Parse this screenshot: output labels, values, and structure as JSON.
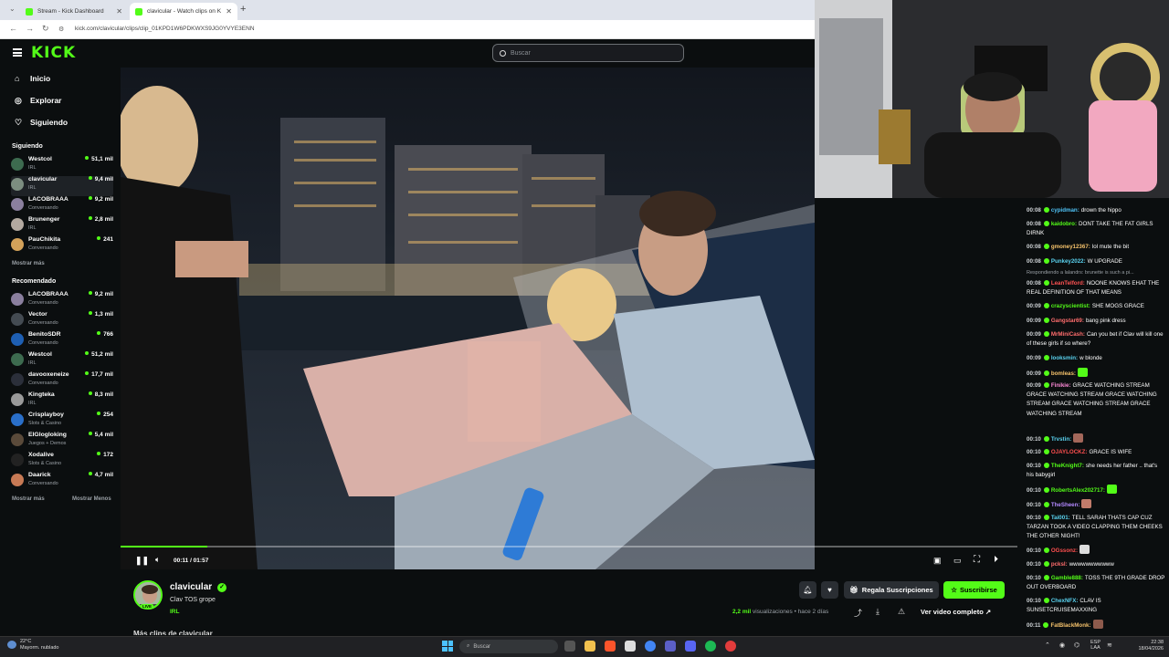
{
  "browser": {
    "tabs": [
      {
        "title": "Stream - Kick Dashboard"
      },
      {
        "title": "clavicular - Watch clips on K"
      }
    ],
    "url": "kick.com/clavicular/clips/clip_01KPD1W6PDKWXS9JG0YVYE3ENN"
  },
  "header": {
    "logo": "KICK",
    "search_placeholder": "Buscar"
  },
  "sidebar": {
    "nav": [
      {
        "label": "Inicio",
        "icon": "home-icon"
      },
      {
        "label": "Explorar",
        "icon": "compass-icon"
      },
      {
        "label": "Siguiendo",
        "icon": "heart-icon"
      }
    ],
    "following_title": "Siguiendo",
    "following": [
      {
        "name": "Westcol",
        "category": "IRL",
        "viewers": "51,1 mil"
      },
      {
        "name": "clavicular",
        "category": "IRL",
        "viewers": "9,4 mil"
      },
      {
        "name": "LACOBRAAA",
        "category": "Conversando",
        "viewers": "9,2 mil"
      },
      {
        "name": "Brunenger",
        "category": "IRL",
        "viewers": "2,8 mil"
      },
      {
        "name": "PauChikita",
        "category": "Conversando",
        "viewers": "241"
      }
    ],
    "following_more": "Mostrar más",
    "recommended_title": "Recomendado",
    "recommended": [
      {
        "name": "LACOBRAAA",
        "category": "Conversando",
        "viewers": "9,2 mil"
      },
      {
        "name": "Vector",
        "category": "Conversando",
        "viewers": "1,3 mil"
      },
      {
        "name": "BenitoSDR",
        "category": "Conversando",
        "viewers": "766"
      },
      {
        "name": "Westcol",
        "category": "IRL",
        "viewers": "51,2 mil"
      },
      {
        "name": "davooxeneize",
        "category": "Conversando",
        "viewers": "17,7 mil"
      },
      {
        "name": "Kingteka",
        "category": "IRL",
        "viewers": "8,3 mil"
      },
      {
        "name": "Crisplayboy",
        "category": "Slots & Casino",
        "viewers": "254"
      },
      {
        "name": "ElGlogloking",
        "category": "Juegos + Demos",
        "viewers": "5,4 mil"
      },
      {
        "name": "Xodalive",
        "category": "Slots & Casino",
        "viewers": "172"
      },
      {
        "name": "Daarick",
        "category": "Conversando",
        "viewers": "4,7 mil"
      }
    ],
    "rec_more": "Mostrar más",
    "rec_less": "Mostrar Menos"
  },
  "player": {
    "time": "00:11 / 01:57",
    "progress": 0.0967
  },
  "clip": {
    "channel": "clavicular",
    "live": "LIVE",
    "title": "Clav TOS grope",
    "category": "IRL",
    "gift_label": "Regala Suscripciones",
    "subscribe_label": "Suscribirse",
    "views": "2,2 mil",
    "views_suffix": " visualizaciones • hace 2 días",
    "full_video": "Ver video completo",
    "more_clips": "Más clips de clavicular"
  },
  "chat": {
    "messages": [
      {
        "time": "00:08",
        "user": "cypidman:",
        "color": "#4fc3f7",
        "text": "drown the hippo"
      },
      {
        "time": "00:08",
        "user": "kaidobro:",
        "color": "#53fc18",
        "text": "DONT TAKE THE FAT GIRLS DIRNK"
      },
      {
        "time": "00:08",
        "user": "gmoney12367:",
        "color": "#f5c26b",
        "text": "lol mute the bit"
      },
      {
        "time": "00:08",
        "user": "Punkey2022:",
        "color": "#5ad3f0",
        "text": "W UPGRADE"
      },
      {
        "reply": "Respondiendo a lalandrs: brunette is such a pi..."
      },
      {
        "time": "00:08",
        "user": "LeanTelford:",
        "color": "#ff5252",
        "text": "NOONE KNOWS EHAT THE REAL DEFINITION OF THAT MEANS"
      },
      {
        "time": "00:09",
        "user": "crazyscientist:",
        "color": "#53fc18",
        "text": "SHE MOGS GRACE"
      },
      {
        "time": "00:09",
        "user": "Gangstar69:",
        "color": "#ff6d6d",
        "text": "bang pink dress"
      },
      {
        "time": "00:09",
        "user": "MrMiniCash:",
        "color": "#ff6d6d",
        "text": "Can you bet if Clav will kill one of these girls if so where?"
      },
      {
        "time": "00:09",
        "user": "looksmin:",
        "color": "#5ad3f0",
        "text": "w blonde"
      },
      {
        "time": "00:09",
        "user": "bomleas:",
        "color": "#f5c26b",
        "text": "",
        "emote": "#53fc18"
      },
      {
        "time": "00:09",
        "user": "Finikie:",
        "color": "#ff8ad8",
        "text": "GRACE WATCHING STREAM GRACE WATCHING STREAM GRACE WATCHING STREAM GRACE WATCHING STREAM GRACE WATCHING STREAM"
      },
      {
        "time": "00:10",
        "user": "Trvstin:",
        "color": "#5ad3f0",
        "text": "",
        "emote": "#a3675a"
      },
      {
        "time": "00:10",
        "user": "OJAYLOCKZ:",
        "color": "#ff4f4f",
        "text": "GRACE IS WIFE"
      },
      {
        "time": "00:10",
        "user": "TheKnight7:",
        "color": "#53fc18",
        "text": "she needs her father .. that's his babygirl"
      },
      {
        "time": "00:10",
        "user": "RobertsAlex202717:",
        "color": "#53fc18",
        "text": "",
        "emote": "#53fc18"
      },
      {
        "time": "00:10",
        "user": "TheSheen:",
        "color": "#b388ff",
        "text": "",
        "emote": "#c27c6b"
      },
      {
        "time": "00:10",
        "user": "Tai001:",
        "color": "#5ad3f0",
        "text": "TELL SARAH THATS CAP CUZ TARZAN TOOK A VIDEO CLAPPING THEM CHEEKS THE OTHER NIGHT!"
      },
      {
        "time": "00:10",
        "user": "OGssonz:",
        "color": "#ff4f4f",
        "text": "",
        "emote": "#dddddd"
      },
      {
        "time": "00:10",
        "user": "pcksl:",
        "color": "#ff6d6d",
        "text": "wwwwwwwwwww"
      },
      {
        "time": "00:10",
        "user": "Gamble888:",
        "color": "#53fc18",
        "text": "TOSS THE 9TH GRADE DROP OUT OVERBOARD"
      },
      {
        "time": "00:10",
        "user": "ChexNFX:",
        "color": "#5ad3f0",
        "text": "CLAV IS SUNSETCRUISEMAXXING"
      },
      {
        "time": "00:11",
        "user": "FatBlackMonk:",
        "color": "#f5c26b",
        "text": "",
        "emote": "#8d5a4c"
      }
    ]
  },
  "taskbar": {
    "temp": "22°C",
    "weather": "Mayorm. nublado",
    "search": "Buscar",
    "lang1": "ESP",
    "lang2": "LAA",
    "time": "22:38",
    "date": "18/04/2026"
  }
}
